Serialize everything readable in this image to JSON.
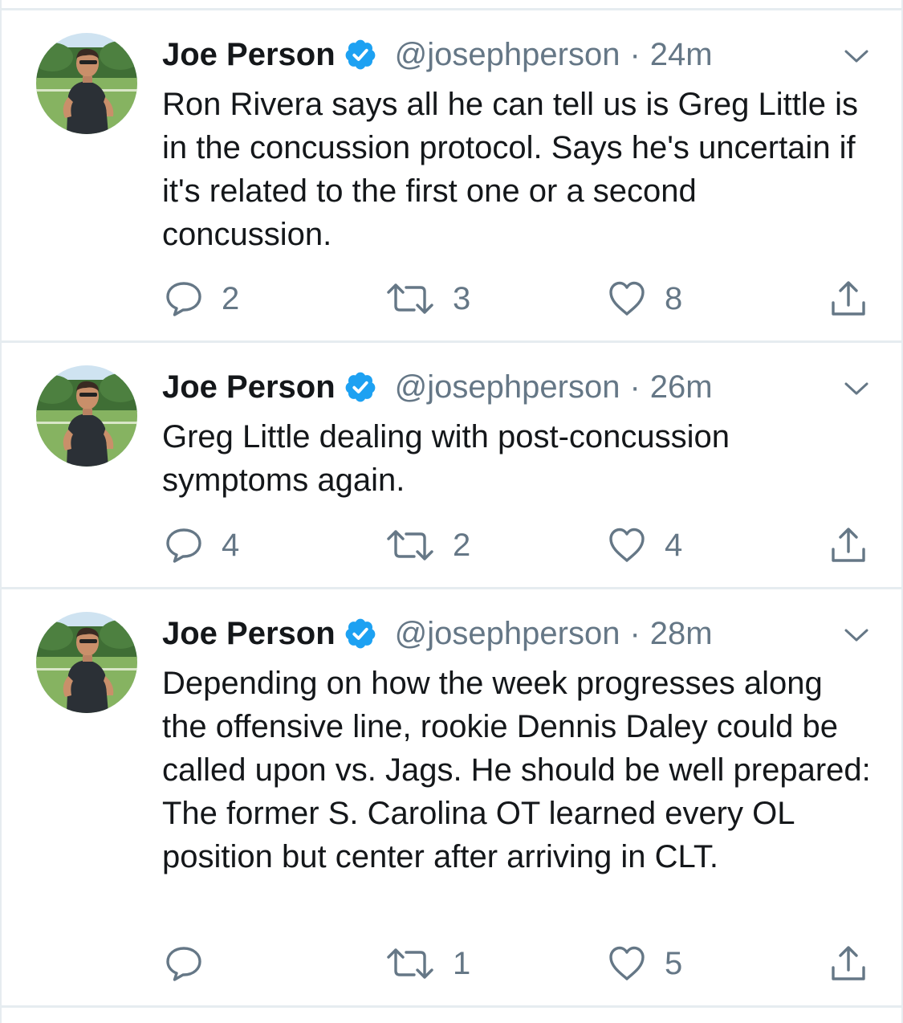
{
  "tweets": [
    {
      "name": "Joe Person",
      "handle": "@josephperson",
      "separator": "·",
      "time": "24m",
      "text": "Ron Rivera says all he can tell us is Greg Little is in the concussion protocol. Says he's uncertain if it's related to the first one or a second concussion.",
      "replies": "2",
      "retweets": "3",
      "likes": "8"
    },
    {
      "name": "Joe Person",
      "handle": "@josephperson",
      "separator": "·",
      "time": "26m",
      "text": "Greg Little dealing with post-concussion symptoms again.",
      "replies": "4",
      "retweets": "2",
      "likes": "4"
    },
    {
      "name": "Joe Person",
      "handle": "@josephperson",
      "separator": "·",
      "time": "28m",
      "text": "Depending on how the week progresses along the offensive line, rookie Dennis Daley could be called upon vs. Jags. He should be well prepared: The former S. Carolina OT learned every OL position but center after arriving in CLT.",
      "replies": "",
      "retweets": "1",
      "likes": "5"
    }
  ],
  "colors": {
    "text": "#14171a",
    "secondary": "#657786",
    "verified": "#1da1f2",
    "divider": "#e6ecf0"
  },
  "icons": [
    "verified-badge-icon",
    "chevron-down-icon",
    "reply-icon",
    "retweet-icon",
    "like-icon",
    "share-icon"
  ]
}
